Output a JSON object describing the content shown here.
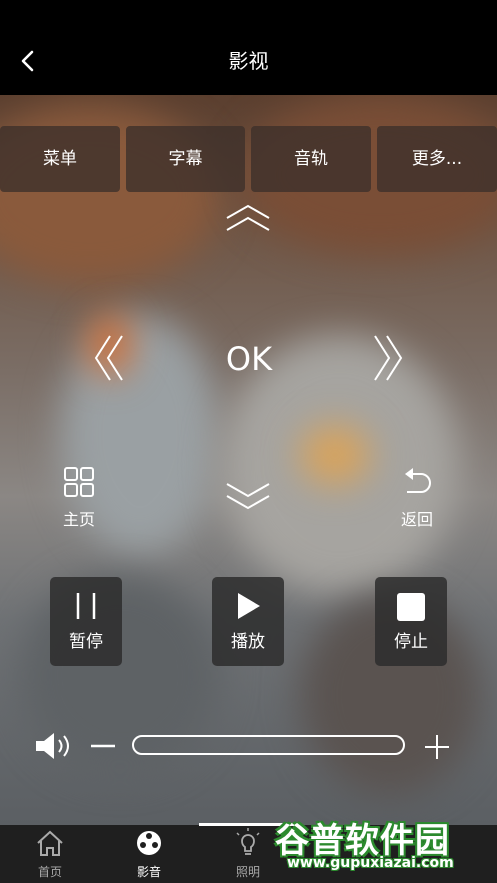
{
  "header": {
    "title": "影视"
  },
  "options": [
    "菜单",
    "字幕",
    "音轨",
    "更多..."
  ],
  "remote": {
    "ok_label": "OK"
  },
  "nav": {
    "home_label": "主页",
    "back_label": "返回"
  },
  "playback": {
    "pause_label": "暂停",
    "play_label": "播放",
    "stop_label": "停止"
  },
  "tabs": {
    "home": "首页",
    "media": "影音",
    "lighting": "照明"
  },
  "watermark": {
    "brand": "谷普软件园",
    "url": "www.gupuxiazai.com"
  }
}
